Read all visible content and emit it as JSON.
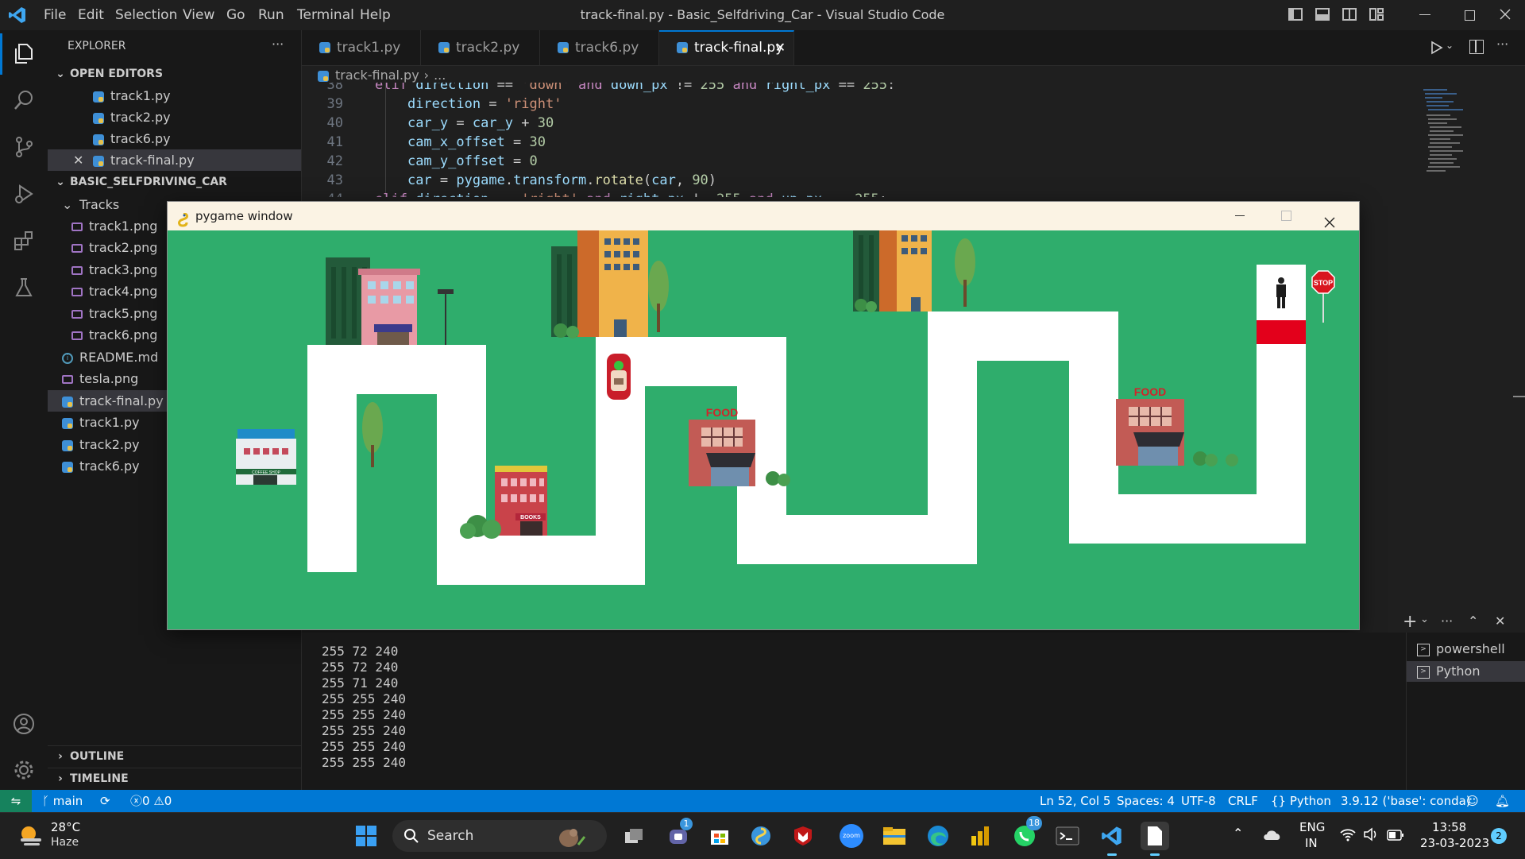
{
  "window": {
    "title": "track-final.py - Basic_Selfdriving_Car - Visual Studio Code"
  },
  "menu": [
    "File",
    "Edit",
    "Selection",
    "View",
    "Go",
    "Run",
    "Terminal",
    "Help"
  ],
  "sidebar": {
    "title": "EXPLORER",
    "more": "···",
    "open_editors_label": "OPEN EDITORS",
    "open_editors": [
      "track1.py",
      "track2.py",
      "track6.py",
      "track-final.py"
    ],
    "project_label": "BASIC_SELFDRIVING_CAR",
    "tracks_folder": "Tracks",
    "track_files": [
      "track1.png",
      "track2.png",
      "track3.png",
      "track4.png",
      "track5.png",
      "track6.png"
    ],
    "root_files": [
      "README.md",
      "tesla.png",
      "track-final.py",
      "track1.py",
      "track2.py",
      "track6.py"
    ],
    "outline_label": "OUTLINE",
    "timeline_label": "TIMELINE"
  },
  "tabs": [
    {
      "label": "track1.py",
      "active": false
    },
    {
      "label": "track2.py",
      "active": false
    },
    {
      "label": "track6.py",
      "active": false
    },
    {
      "label": "track-final.py",
      "active": true
    }
  ],
  "breadcrumb": {
    "file": "track-final.py",
    "rest": "..."
  },
  "editor": {
    "line_numbers": [
      "38",
      "39",
      "40",
      "41",
      "42",
      "43",
      "44"
    ],
    "lines": [
      "elif direction == 'down' and down_px != 255 and right_px == 255:",
      "    direction = 'right'",
      "    car_y = car_y + 30",
      "    cam_x_offset = 30",
      "    cam_y_offset = 0",
      "    car = pygame.transform.rotate(car, 90)",
      "elif direction == 'right' and right_px != 255 and up_px == 255:"
    ]
  },
  "pygame": {
    "title": "pygame window",
    "food_sign": "FOOD",
    "books_sign": "BOOKS",
    "coffee_sign": "COFFEE SHOP",
    "stop_sign": "STOP"
  },
  "terminal": {
    "output": [
      "255 72 240",
      "255 72 240",
      "255 71 240",
      "255 255 240",
      "255 255 240",
      "255 255 240",
      "255 255 240",
      "255 255 240"
    ],
    "sessions": [
      "powershell",
      "Python"
    ]
  },
  "statusbar": {
    "branch": "main",
    "errors": "0",
    "warnings": "0",
    "position": "Ln 52, Col 5",
    "spaces": "Spaces: 4",
    "encoding": "UTF-8",
    "eol": "CRLF",
    "language": "Python",
    "interpreter": "3.9.12 ('base': conda)"
  },
  "taskbar": {
    "weather_temp": "28°C",
    "weather_desc": "Haze",
    "search": "Search",
    "zoom_label": "zoom",
    "teams_badge": "1",
    "whatsapp_badge": "18",
    "lang_line1": "ENG",
    "lang_line2": "IN",
    "time": "13:58",
    "date": "23-03-2023",
    "notifications": "2"
  },
  "colors": {
    "accent": "#0078d4",
    "grass": "#2fad6c",
    "road": "#ffffff",
    "finish": "#e3001b"
  }
}
